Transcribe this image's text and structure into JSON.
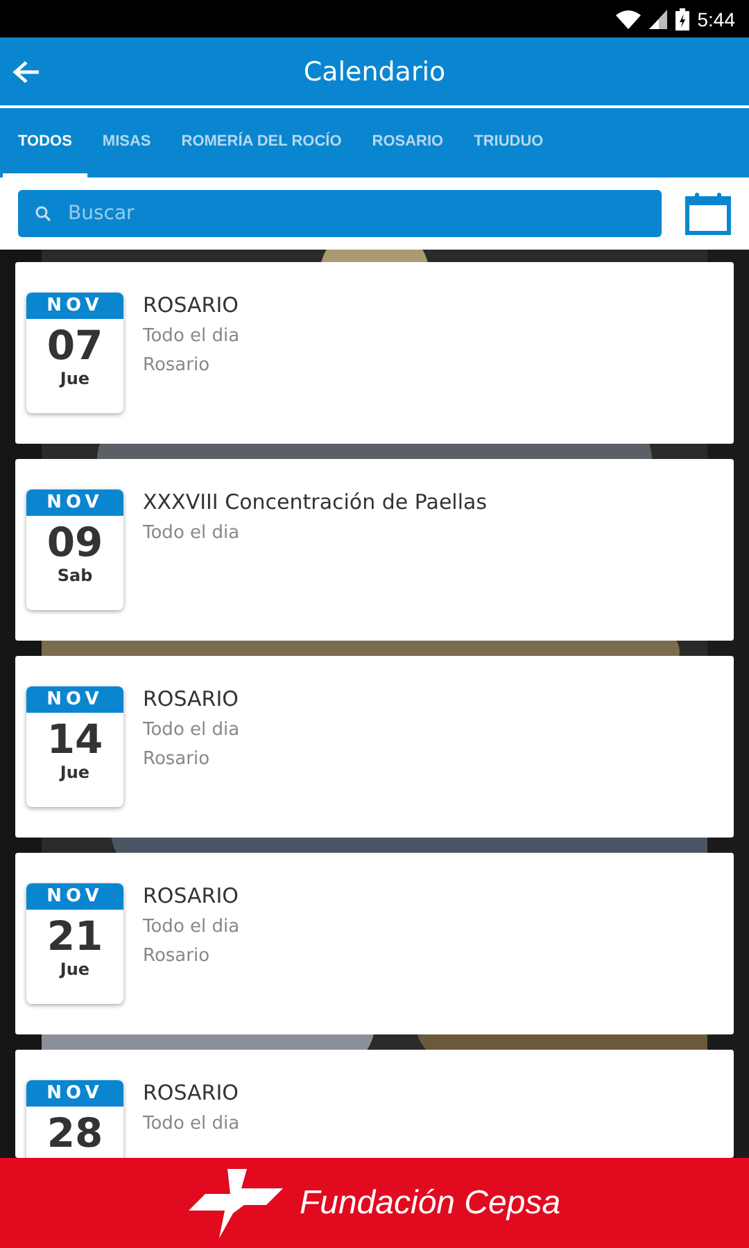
{
  "status_bar": {
    "time": "5:44"
  },
  "app_bar": {
    "title": "Calendario"
  },
  "tabs": [
    {
      "label": "TODOS",
      "selected": true
    },
    {
      "label": "MISAS",
      "selected": false
    },
    {
      "label": "ROMERÍA DEL ROCÍO",
      "selected": false
    },
    {
      "label": "ROSARIO",
      "selected": false
    },
    {
      "label": "TRIUDUO",
      "selected": false
    }
  ],
  "search": {
    "placeholder": "Buscar"
  },
  "events": [
    {
      "month": "NOV",
      "day": "07",
      "weekday": "Jue",
      "title": "ROSARIO",
      "lines": [
        "Todo el dia",
        "Rosario"
      ]
    },
    {
      "month": "NOV",
      "day": "09",
      "weekday": "Sab",
      "title": "XXXVIII Concentración de Paellas",
      "lines": [
        "Todo el dia"
      ]
    },
    {
      "month": "NOV",
      "day": "14",
      "weekday": "Jue",
      "title": "ROSARIO",
      "lines": [
        "Todo el dia",
        "Rosario"
      ]
    },
    {
      "month": "NOV",
      "day": "21",
      "weekday": "Jue",
      "title": "ROSARIO",
      "lines": [
        "Todo el dia",
        "Rosario"
      ]
    },
    {
      "month": "NOV",
      "day": "28",
      "title": "ROSARIO",
      "lines": [
        "Todo el dia"
      ]
    }
  ],
  "footer": {
    "brand": "Fundación Cepsa"
  }
}
